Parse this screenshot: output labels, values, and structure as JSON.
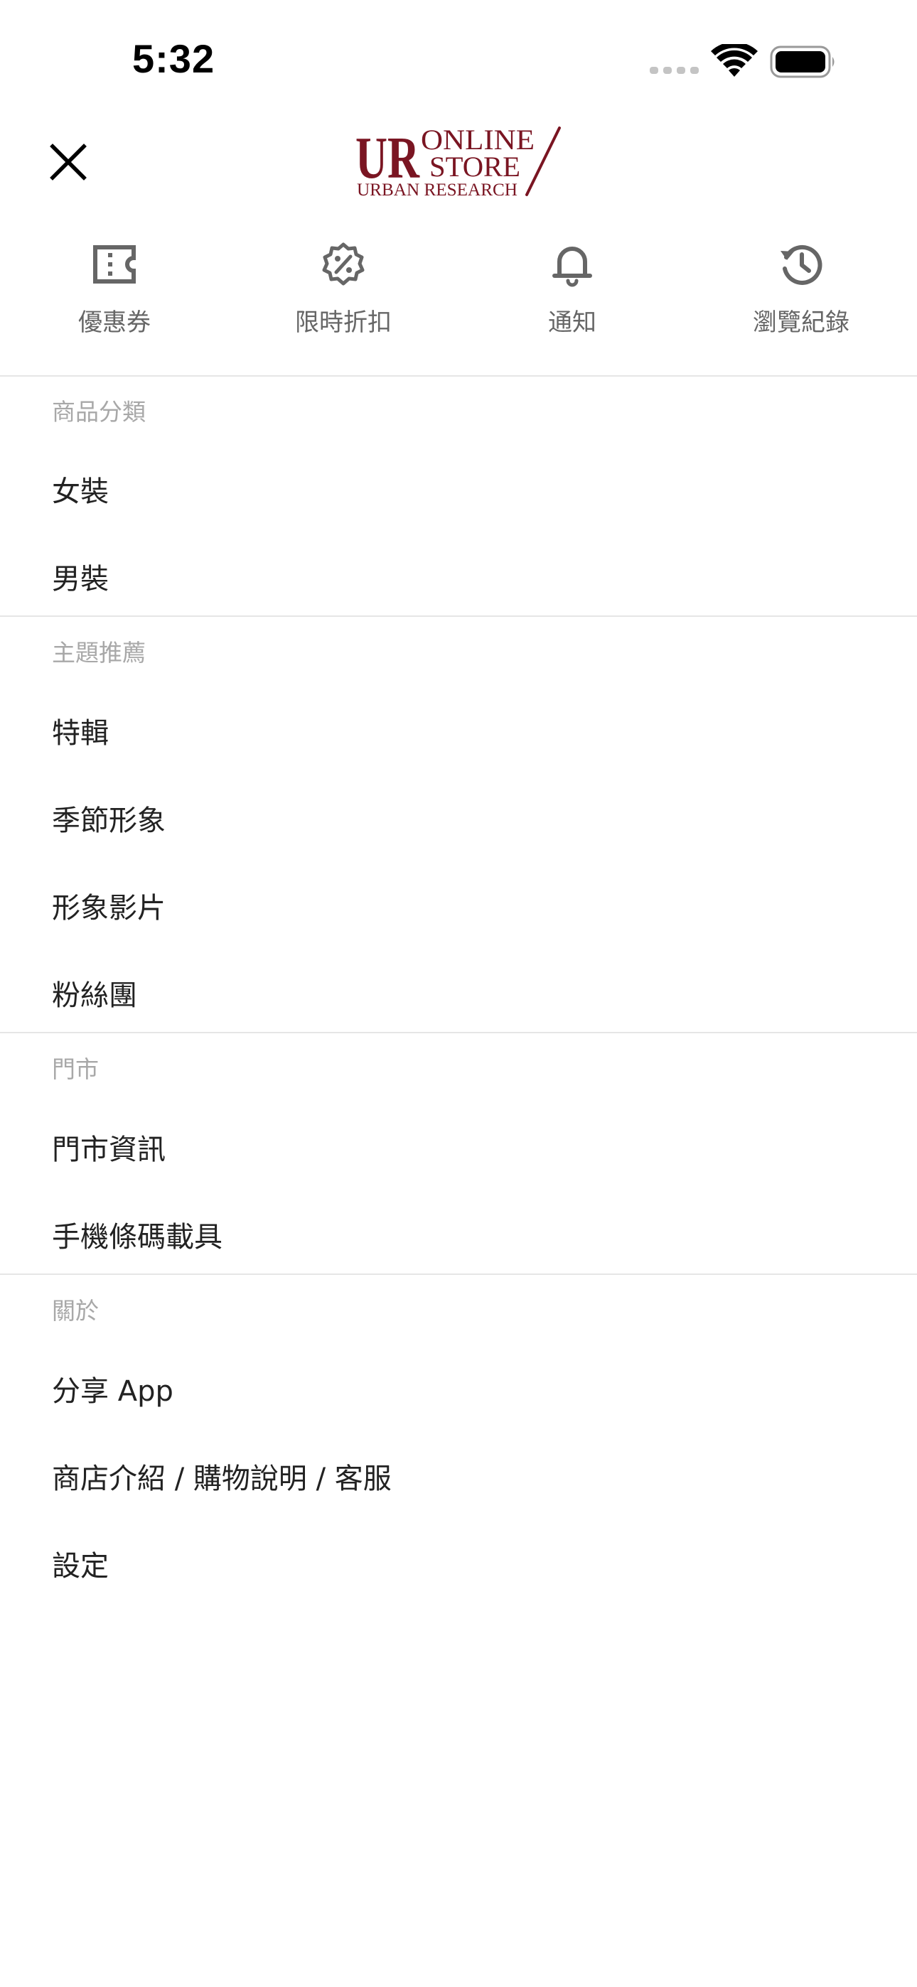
{
  "status_bar": {
    "time": "5:32"
  },
  "header": {
    "logo": {
      "mark": "UR",
      "line1": "ONLINE",
      "line2": "STORE",
      "line3": "URBAN RESEARCH"
    },
    "brand_color": "#7a1522"
  },
  "quick_actions": [
    {
      "label": "優惠券",
      "icon": "ticket-icon"
    },
    {
      "label": "限時折扣",
      "icon": "percent-badge-icon"
    },
    {
      "label": "通知",
      "icon": "bell-icon"
    },
    {
      "label": "瀏覽紀錄",
      "icon": "history-icon"
    }
  ],
  "sections": [
    {
      "title": "商品分類",
      "items": [
        "女裝",
        "男裝"
      ]
    },
    {
      "title": "主題推薦",
      "items": [
        "特輯",
        "季節形象",
        "形象影片",
        "粉絲團"
      ]
    },
    {
      "title": "門市",
      "items": [
        "門市資訊",
        "手機條碼載具"
      ]
    },
    {
      "title": "關於",
      "items": [
        "分享 App",
        "商店介紹 / 購物說明 / 客服",
        "設定"
      ]
    }
  ]
}
